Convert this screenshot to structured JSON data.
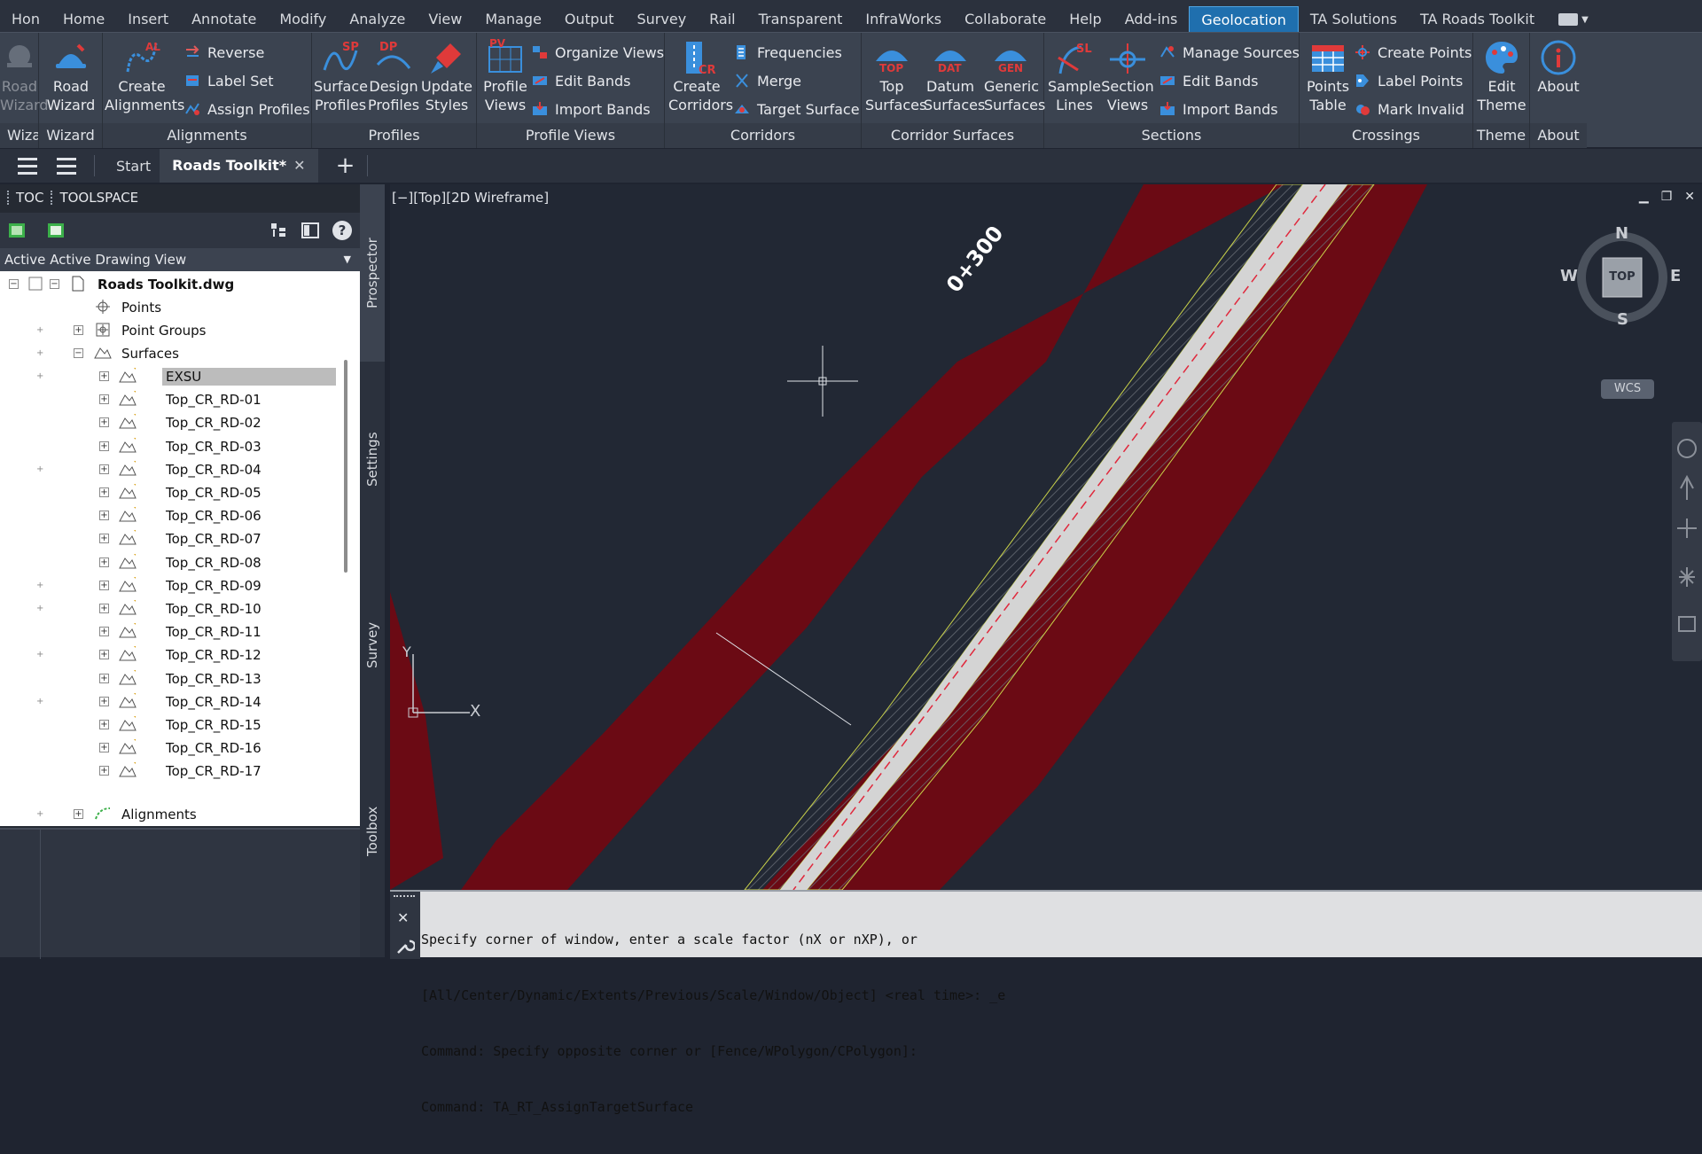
{
  "menu": {
    "tabs": [
      "Hon",
      "Home",
      "Insert",
      "Annotate",
      "Modify",
      "Analyze",
      "View",
      "Manage",
      "Output",
      "Survey",
      "Rail",
      "Transparent",
      "InfraWorks",
      "Collaborate",
      "Help",
      "Add-ins",
      "Geolocation",
      "TA Solutions",
      "TA Roads Toolkit"
    ],
    "active_tab": "Geolocation"
  },
  "ribbon": {
    "groups": {
      "wizard_a": "Wizar",
      "wizard": "Wizard",
      "alignments": "Alignments",
      "profiles": "Profiles",
      "profile_views": "Profile Views",
      "corridors": "Corridors",
      "corridor_surfaces": "Corridor Surfaces",
      "sections": "Sections",
      "crossings": "Crossings",
      "theme": "Theme",
      "about": "About"
    },
    "buttons": {
      "road_wizard_cut": [
        "Road",
        "Wizard"
      ],
      "road_wizard": [
        "Road",
        "Wizard"
      ],
      "create_alignments": [
        "Create",
        "Alignments"
      ],
      "reverse": "Reverse",
      "label_set": "Label Set",
      "assign_profiles": "Assign Profiles",
      "surface_profiles": [
        "Surface",
        "Profiles"
      ],
      "design_profiles": [
        "Design",
        "Profiles"
      ],
      "update_styles": [
        "Update",
        "Styles"
      ],
      "profile_views": [
        "Profile",
        "Views"
      ],
      "organize_views": "Organize Views",
      "edit_bands": "Edit Bands",
      "import_bands": "Import Bands",
      "create_corridors": [
        "Create",
        "Corridors"
      ],
      "frequencies": "Frequencies",
      "merge": "Merge",
      "target_surface": "Target Surface",
      "top_surfaces": [
        "Top",
        "Surfaces"
      ],
      "datum_surfaces": [
        "Datum",
        "Surfaces"
      ],
      "generic_surfaces": [
        "Generic",
        "Surfaces"
      ],
      "sample_lines": [
        "Sample",
        "Lines"
      ],
      "section_views": [
        "Section",
        "Views"
      ],
      "manage_sources": "Manage Sources",
      "sec_edit_bands": "Edit Bands",
      "sec_import_bands": "Import Bands",
      "points_table": [
        "Points",
        "Table"
      ],
      "create_points": "Create Points",
      "label_points": "Label Points",
      "mark_invalid": "Mark Invalid",
      "edit_theme": [
        "Edit",
        "Theme"
      ],
      "about": [
        "About"
      ]
    },
    "icon_tags": {
      "sp": "SP",
      "dp": "DP",
      "pv": "PV",
      "al": "AL",
      "cr": "CR",
      "sl": "SL",
      "top": "TOP",
      "dat": "DAT",
      "gen": "GEN"
    }
  },
  "docbar": {
    "start": "Start",
    "active_doc": "Roads Toolkit*",
    "close": "✕",
    "new": "+"
  },
  "toolspace": {
    "title_toc": "TOC",
    "title": "TOOLSPACE",
    "view_prefix": "Active",
    "view": "Active Drawing View",
    "help": "?",
    "tree": {
      "root": "Roads Toolkit.dwg",
      "points": "Points",
      "point_groups": "Point Groups",
      "surfaces": "Surfaces",
      "surface_items": [
        "EXSU",
        "Top_CR_RD-01",
        "Top_CR_RD-02",
        "Top_CR_RD-03",
        "Top_CR_RD-04",
        "Top_CR_RD-05",
        "Top_CR_RD-06",
        "Top_CR_RD-07",
        "Top_CR_RD-08",
        "Top_CR_RD-09",
        "Top_CR_RD-10",
        "Top_CR_RD-11",
        "Top_CR_RD-12",
        "Top_CR_RD-13",
        "Top_CR_RD-14",
        "Top_CR_RD-15",
        "Top_CR_RD-16",
        "Top_CR_RD-17"
      ],
      "selected": "EXSU",
      "alignments": "Alignments"
    },
    "side_tabs": [
      "Prospector",
      "Settings",
      "Survey",
      "Toolbox"
    ]
  },
  "viewport": {
    "label": "[−][Top][2D Wireframe]",
    "controls": [
      "▁",
      "❐",
      "✕"
    ],
    "compass": {
      "n": "N",
      "s": "S",
      "e": "E",
      "w": "W",
      "top": "TOP"
    },
    "wcs": "WCS",
    "road_label": "0+300",
    "ucs": {
      "x": "X",
      "y": "Y"
    },
    "colors": {
      "ground": "#222834",
      "slope": "#6b0a14",
      "shoulder": "#2a2f35",
      "lane": "#d4d4d4",
      "centerline": "#e0283c",
      "offset": "#c9d24a"
    }
  },
  "command_line": {
    "lines": [
      "Specify corner of window, enter a scale factor (nX or nXP), or",
      "[All/Center/Dynamic/Extents/Previous/Scale/Window/Object] <real time>: _e",
      "Command: Specify opposite corner or [Fence/WPolygon/CPolygon]:",
      "Command: TA_RT_AssignTargetSurface"
    ],
    "close": "✕"
  }
}
